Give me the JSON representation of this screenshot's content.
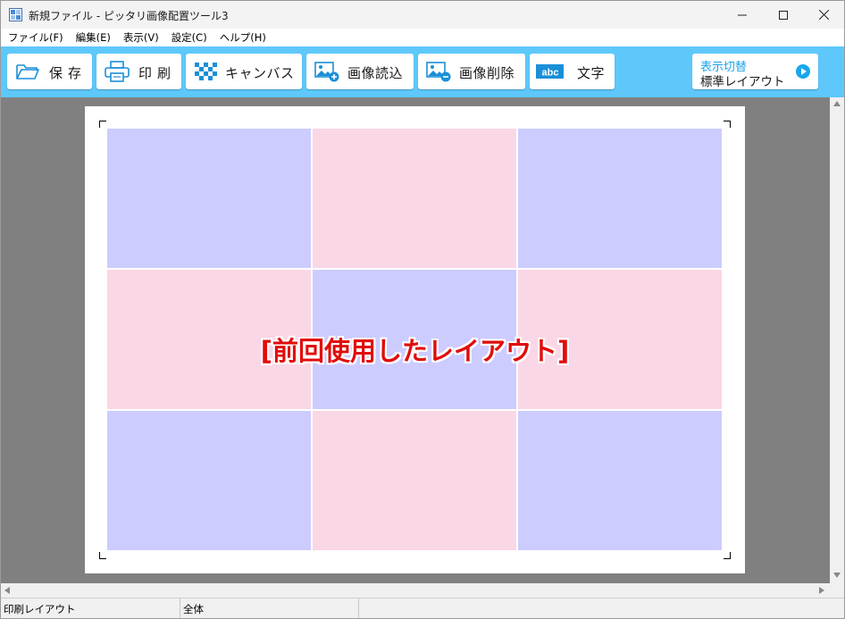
{
  "window": {
    "title": "新規ファイル - ピッタリ画像配置ツール3"
  },
  "menu": {
    "items": [
      "ファイル(F)",
      "編集(E)",
      "表示(V)",
      "設定(C)",
      "ヘルプ(H)"
    ]
  },
  "toolbar": {
    "save_label": "保存",
    "print_label": "印刷",
    "canvas_label": "キャンバス",
    "image_load_label": "画像読込",
    "image_delete_label": "画像削除",
    "text_label": "文字",
    "text_icon_text": "abc",
    "view_switch_title": "表示切替",
    "view_switch_value": "標準レイアウト",
    "accent_color": "#5ec8fb"
  },
  "canvas": {
    "grid_rows": 3,
    "grid_cols": 3,
    "cell_colors": [
      "#ccccff",
      "#fad7e6"
    ],
    "overlay_label": "[前回使用したレイアウト]",
    "overlay_color": "#e10c0c"
  },
  "status": {
    "pane1": "印刷レイアウト",
    "pane2": "全体"
  }
}
